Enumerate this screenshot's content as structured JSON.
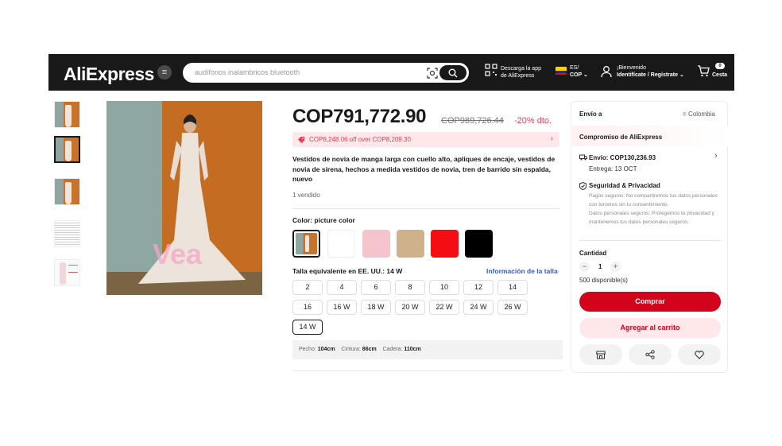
{
  "header": {
    "logo": "AliExpress",
    "search_placeholder": "audífonos inalambricos bluetooth",
    "app_line1": "Descarga la app",
    "app_line2": "de AliExpress",
    "lang": "ES/",
    "currency": "COP",
    "greeting": "¡Bienvenido",
    "signin": "Identifícate / Regístrate",
    "cart_count": "0",
    "cart_label": "Cesta"
  },
  "gallery": {
    "thumbnails": [
      "thumb-1",
      "thumb-2",
      "thumb-3",
      "thumb-4",
      "thumb-5"
    ],
    "watermark": "Vea"
  },
  "product": {
    "price": "COP791,772.90",
    "old_price": "COP989,726.44",
    "discount": "-20% dto.",
    "coupon": "COP8,248.06 off over COP8,209.30",
    "title": "Vestidos de novia de manga larga con cuello alto, apliques de encaje, vestidos de novia de sirena, hechos a medida vestidos de novia, tren de barrido sin espalda, nuevo",
    "sold": "1 vendido",
    "color_label": "Color: picture color",
    "colors": [
      "#ffffff",
      "#f6c4cd",
      "#cfb18c",
      "#f40d12",
      "#000000"
    ],
    "size_label": "Talla equivalente en EE. UU.: 14 W",
    "size_info": "Información de la talla",
    "sizes_row1": [
      "2",
      "4",
      "6",
      "8",
      "10",
      "12",
      "14"
    ],
    "sizes_row2": [
      "16",
      "16 W",
      "18 W",
      "20 W",
      "22 W",
      "24 W",
      "26 W"
    ],
    "sizes_row3": [
      "14 W"
    ],
    "measure": {
      "chest_label": "Pecho:",
      "chest": "104cm",
      "waist_label": "Cintura:",
      "waist": "86cm",
      "hip_label": "Cadera:",
      "hip": "110cm"
    }
  },
  "panel": {
    "ship_to": "Envío a",
    "country": "Colombia",
    "compromiso": "Compromiso de AliExpress",
    "shipping": "Envío: COP130,236.93",
    "delivery": "Entrega: 13 OCT",
    "security_title": "Seguridad & Privacidad",
    "security_p1": "Pagos seguros: No compartiremos tus datos personales con terceros sin tu consentimiento.",
    "security_p2": "Datos personales seguros: Protegemos tu privacidad y mantenemos tus datos personales seguros.",
    "qty_label": "Cantidad",
    "qty_minus": "−",
    "qty": "1",
    "qty_plus": "+",
    "available": "500 disponible(s)",
    "buy": "Comprar",
    "add_cart": "Agregar al carrito"
  }
}
